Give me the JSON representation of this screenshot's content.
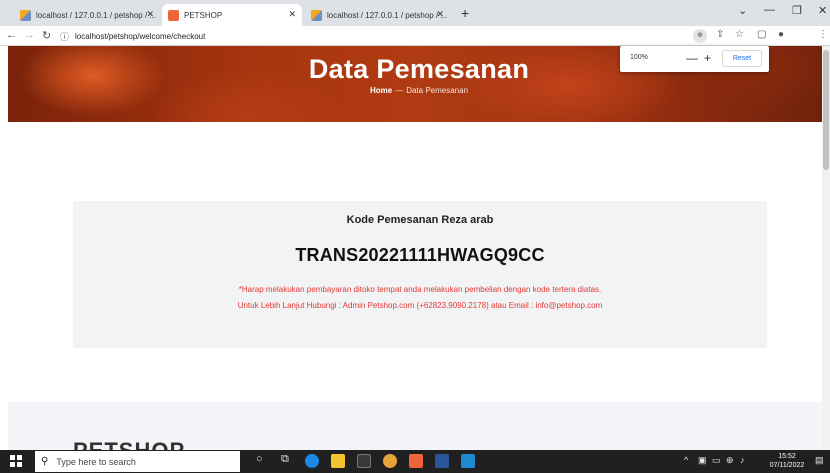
{
  "browser": {
    "tabs": [
      {
        "title": "localhost / 127.0.0.1 / petshop / ...",
        "favicon": "phpmyadmin-icon",
        "active": false
      },
      {
        "title": "PETSHOP",
        "favicon": "petshop-icon",
        "active": true
      },
      {
        "title": "localhost / 127.0.0.1 / petshop / ...",
        "favicon": "phpmyadmin-icon",
        "active": false
      }
    ],
    "url": "localhost/petshop/welcome/checkout",
    "zoom": {
      "percent": "100%",
      "reset_label": "Reset"
    }
  },
  "hero": {
    "title": "Data Pemesanan",
    "breadcrumb_home": "Home",
    "breadcrumb_sep": "—",
    "breadcrumb_current": "Data Pemesanan"
  },
  "order": {
    "label": "Kode Pemesanan Reza arab",
    "code": "TRANS20221111HWAGQ9CC",
    "note_line1": "*Harap melakukan pembayaran ditoko tempat anda melakukan pembelian dengan kode tertera diatas.",
    "note_line2": "Untuk Lebih Lanjut Hubungi : Admin Petshop.com (+62823.9090.2178) atau Email : info@petshop.com"
  },
  "footer": {
    "brand": "PETSHOP"
  },
  "taskbar": {
    "search_placeholder": "Type here to search",
    "time": "15:52",
    "date": "07/11/2022"
  },
  "colors": {
    "accent_red": "#e53935",
    "hero_brown": "#a8350f",
    "taskbar": "#202020"
  }
}
